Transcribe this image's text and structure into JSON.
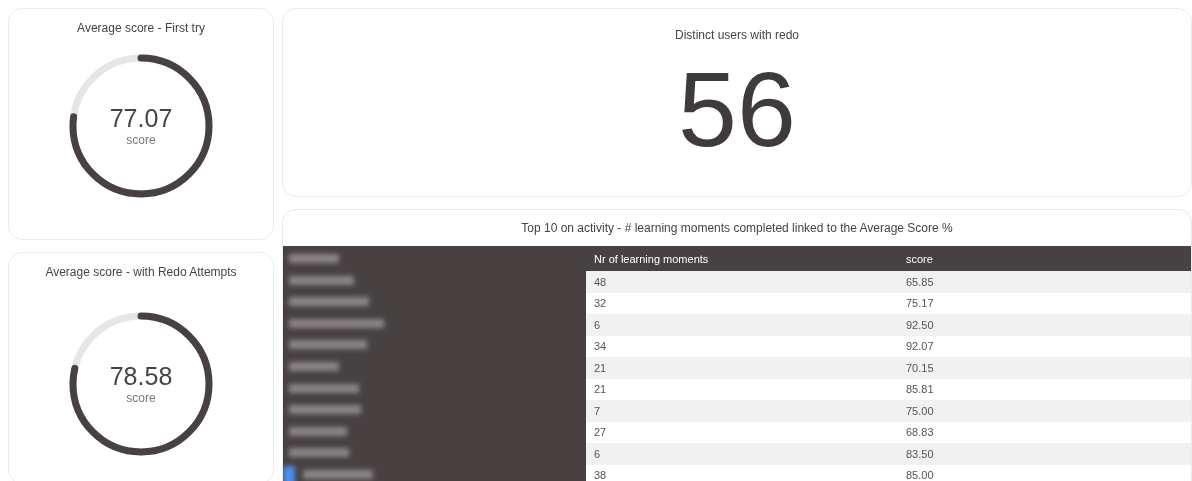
{
  "gauges": [
    {
      "title": "Average score - First try",
      "value": "77.07",
      "unit": "score",
      "level": 0.7707
    },
    {
      "title": "Average score - with Redo Attempts",
      "value": "78.58",
      "unit": "score",
      "level": 0.7858
    }
  ],
  "kpi": {
    "title": "Distinct users with redo",
    "value": "56"
  },
  "table": {
    "title": "Top 10 on activity - # learning moments completed linked to the Average Score %",
    "columns": [
      "Nr of learning moments",
      "score"
    ],
    "rows": [
      [
        "48",
        "65.85"
      ],
      [
        "32",
        "75.17"
      ],
      [
        "6",
        "92.50"
      ],
      [
        "34",
        "92.07"
      ],
      [
        "21",
        "70.15"
      ],
      [
        "21",
        "85.81"
      ],
      [
        "7",
        "75.00"
      ],
      [
        "27",
        "68.83"
      ],
      [
        "6",
        "83.50"
      ],
      [
        "38",
        "85.00"
      ]
    ]
  }
}
